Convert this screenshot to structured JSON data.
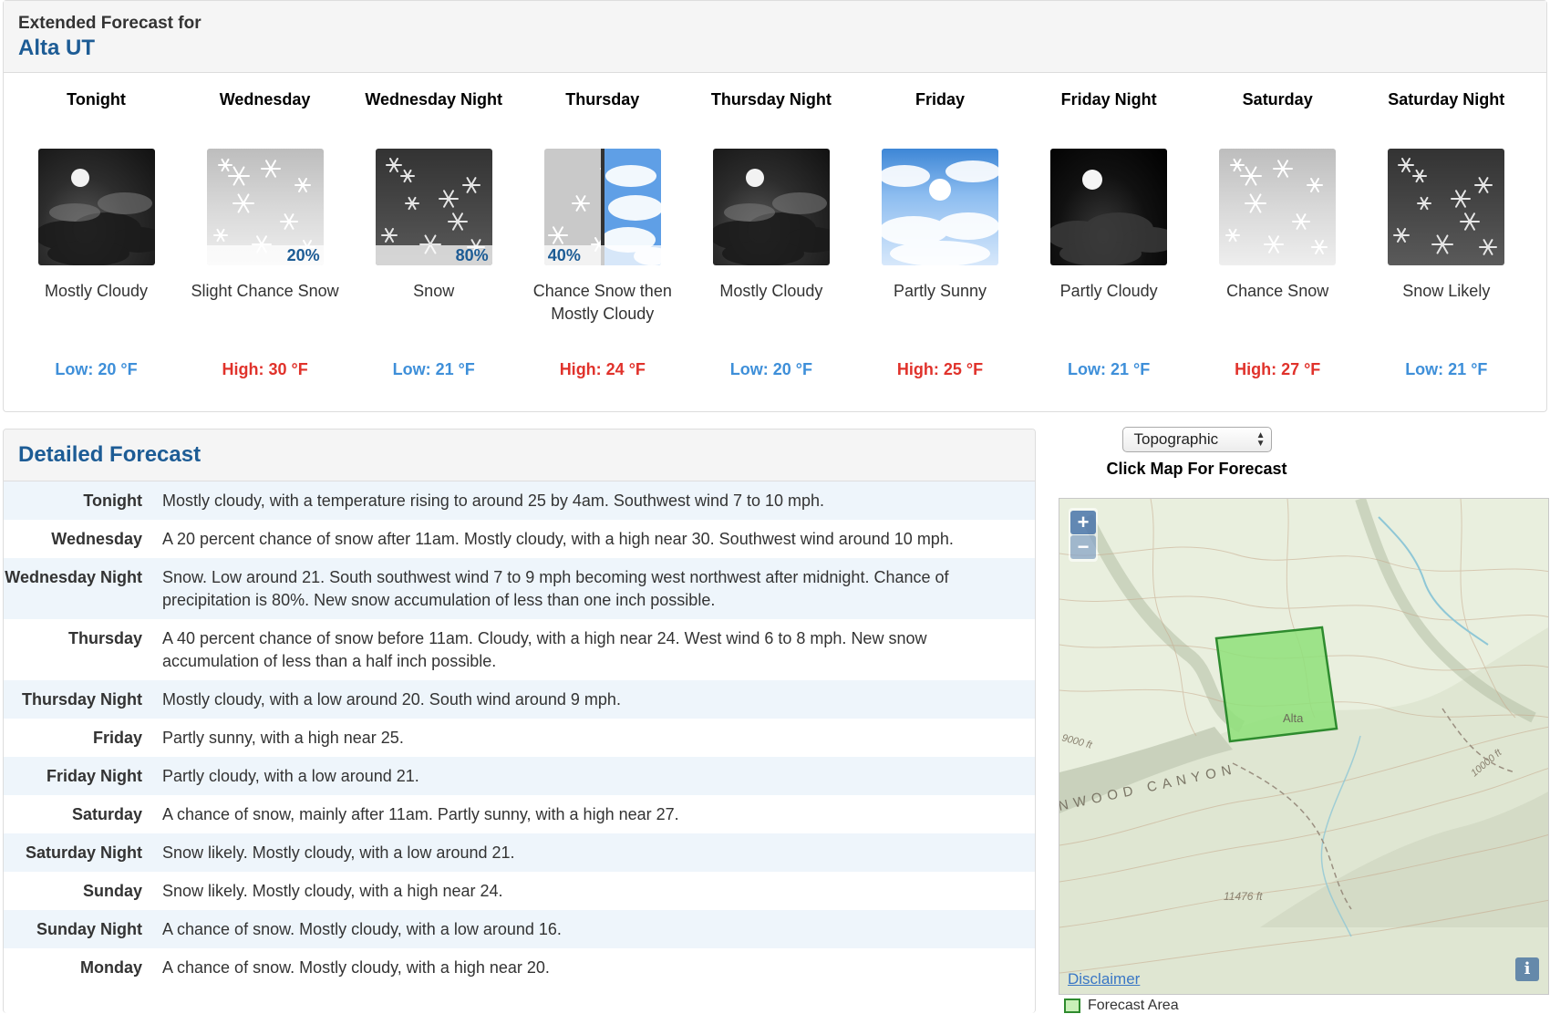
{
  "extended": {
    "label": "Extended Forecast for",
    "location": "Alta UT"
  },
  "periods": [
    {
      "name": "Tonight",
      "icon": "night-mostly-cloudy-icon",
      "pop": "",
      "desc": "Mostly Cloudy",
      "temp": "Low: 20 °F",
      "kind": "low"
    },
    {
      "name": "Wednesday",
      "icon": "snow-day-icon",
      "pop": "20%",
      "desc": "Slight Chance Snow",
      "temp": "High: 30 °F",
      "kind": "high"
    },
    {
      "name": "Wednesday Night",
      "icon": "snow-night-icon",
      "pop": "80%",
      "desc": "Snow",
      "temp": "Low: 21 °F",
      "kind": "low"
    },
    {
      "name": "Thursday",
      "icon": "snow-then-cloudy-icon",
      "pop": "40%",
      "desc": "Chance Snow then Mostly Cloudy",
      "temp": "High: 24 °F",
      "kind": "high"
    },
    {
      "name": "Thursday Night",
      "icon": "night-mostly-cloudy-icon",
      "pop": "",
      "desc": "Mostly Cloudy",
      "temp": "Low: 20 °F",
      "kind": "low"
    },
    {
      "name": "Friday",
      "icon": "partly-sunny-icon",
      "pop": "",
      "desc": "Partly Sunny",
      "temp": "High: 25 °F",
      "kind": "high"
    },
    {
      "name": "Friday Night",
      "icon": "night-partly-cloudy-icon",
      "pop": "",
      "desc": "Partly Cloudy",
      "temp": "Low: 21 °F",
      "kind": "low"
    },
    {
      "name": "Saturday",
      "icon": "snow-day-icon",
      "pop": "",
      "desc": "Chance Snow",
      "temp": "High: 27 °F",
      "kind": "high"
    },
    {
      "name": "Saturday Night",
      "icon": "snow-night-icon",
      "pop": "",
      "desc": "Snow Likely",
      "temp": "Low: 21 °F",
      "kind": "low"
    }
  ],
  "detailed": {
    "title": "Detailed Forecast",
    "rows": [
      {
        "label": "Tonight",
        "text": "Mostly cloudy, with a temperature rising to around 25 by 4am. Southwest wind 7 to 10 mph."
      },
      {
        "label": "Wednesday",
        "text": "A 20 percent chance of snow after 11am. Mostly cloudy, with a high near 30. Southwest wind around 10 mph."
      },
      {
        "label": "Wednesday Night",
        "text": "Snow. Low around 21. South southwest wind 7 to 9 mph becoming west northwest after midnight. Chance of precipitation is 80%. New snow accumulation of less than one inch possible."
      },
      {
        "label": "Thursday",
        "text": "A 40 percent chance of snow before 11am. Cloudy, with a high near 24. West wind 6 to 8 mph. New snow accumulation of less than a half inch possible."
      },
      {
        "label": "Thursday Night",
        "text": "Mostly cloudy, with a low around 20. South wind around 9 mph."
      },
      {
        "label": "Friday",
        "text": "Partly sunny, with a high near 25."
      },
      {
        "label": "Friday Night",
        "text": "Partly cloudy, with a low around 21."
      },
      {
        "label": "Saturday",
        "text": "A chance of snow, mainly after 11am. Partly sunny, with a high near 27."
      },
      {
        "label": "Saturday Night",
        "text": "Snow likely. Mostly cloudy, with a low around 21."
      },
      {
        "label": "Sunday",
        "text": "Snow likely. Mostly cloudy, with a high near 24."
      },
      {
        "label": "Sunday Night",
        "text": "A chance of snow. Mostly cloudy, with a low around 16."
      },
      {
        "label": "Monday",
        "text": "A chance of snow. Mostly cloudy, with a high near 20."
      }
    ]
  },
  "map": {
    "layer_select": "Topographic",
    "click_hint": "Click Map For Forecast",
    "zoom_in": "+",
    "zoom_out": "−",
    "disclaimer": "Disclaimer",
    "info": "i",
    "labels": {
      "canyon": "NWOOD CANYON",
      "alta": "Alta",
      "elev1": "11476 ft",
      "elev2": "10000 ft",
      "elev3": "9000 ft"
    },
    "legend": "Forecast Area",
    "colors": {
      "forecast_area_fill": "#8fe07a",
      "forecast_area_stroke": "#2e8b2e"
    }
  },
  "colors": {
    "accent": "#1d5c95",
    "low": "#3e8fd9",
    "high": "#e0322b"
  }
}
